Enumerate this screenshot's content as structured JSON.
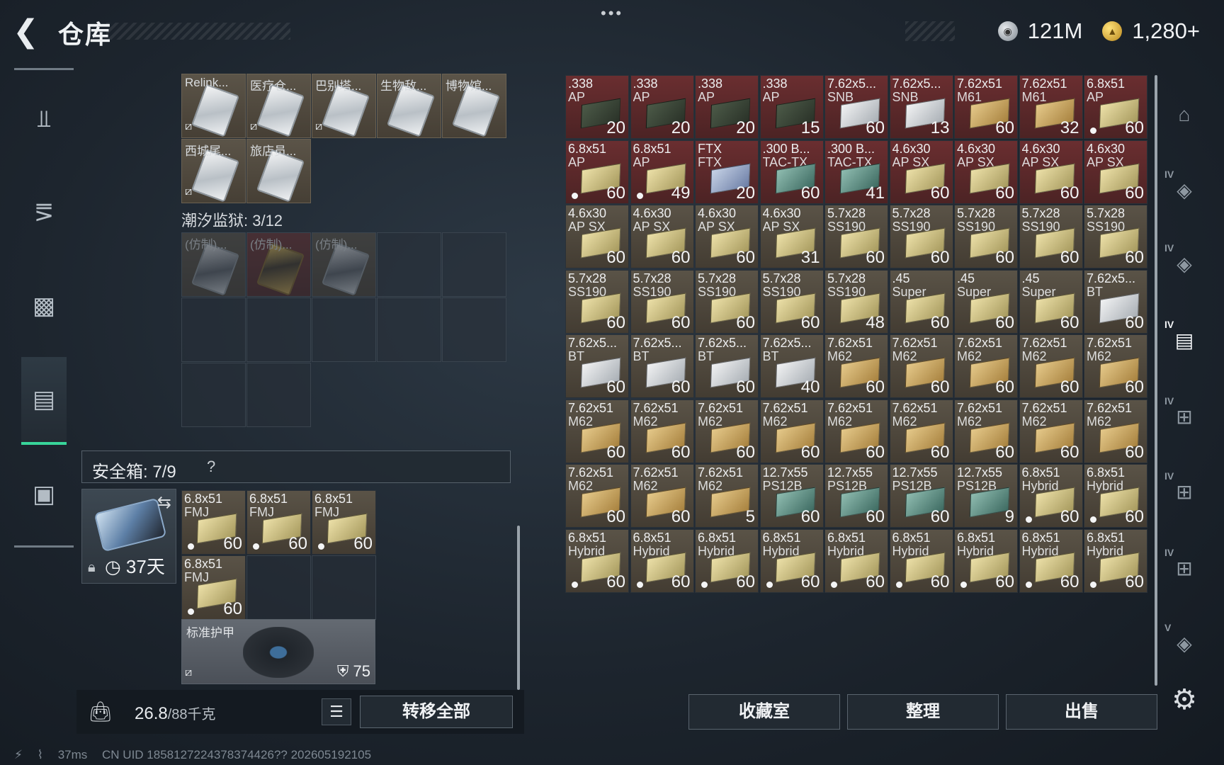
{
  "header": {
    "title": "仓库",
    "more_label": "•••",
    "currency": [
      {
        "icon": "silver-coin-icon",
        "value": "121M"
      },
      {
        "icon": "gold-coin-icon",
        "value": "1,280+"
      }
    ]
  },
  "left_storage": {
    "keycards_row1": [
      {
        "label": "Relink...",
        "nobind": true,
        "style": "silver"
      },
      {
        "label": "医疗仓...",
        "nobind": true,
        "style": "silver"
      },
      {
        "label": "巴别塔...",
        "nobind": true,
        "style": "silver"
      },
      {
        "label": "生物敌...",
        "nobind": false,
        "style": "silver"
      },
      {
        "label": "博物馆...",
        "nobind": false,
        "style": "silver"
      }
    ],
    "keycards_row2": [
      {
        "label": "西城尾...",
        "nobind": true,
        "style": "silver"
      },
      {
        "label": "旅店员...",
        "nobind": false,
        "style": "silver"
      }
    ],
    "prison_title": "潮汐监狱: 3/12",
    "prison_cards": [
      {
        "label": "(仿制)...",
        "style": "dark",
        "red": false
      },
      {
        "label": "(仿制)...",
        "style": "gold",
        "red": true
      },
      {
        "label": "(仿制)...",
        "style": "dark",
        "red": false
      }
    ]
  },
  "safebox": {
    "label": "安全箱:  7/9",
    "help": "?",
    "timer": "37天",
    "items": [
      {
        "name1": "6.8x51",
        "name2": "FMJ",
        "count": "60",
        "dot": true
      },
      {
        "name1": "6.8x51",
        "name2": "FMJ",
        "count": "60",
        "dot": true
      },
      {
        "name1": "6.8x51",
        "name2": "FMJ",
        "count": "60",
        "dot": true
      },
      {
        "name1": "6.8x51",
        "name2": "FMJ",
        "count": "60",
        "dot": true
      }
    ],
    "armor": {
      "label": "标准护甲",
      "value": "75"
    }
  },
  "bottom_left": {
    "weight": "26.8",
    "weight_max": "/88千克",
    "transfer_all": "转移全部"
  },
  "stash": [
    {
      "n1": ".338",
      "n2": "AP",
      "c": "20",
      "bg": "red",
      "box": "green",
      "dot": false
    },
    {
      "n1": ".338",
      "n2": "AP",
      "c": "20",
      "bg": "red",
      "box": "green",
      "dot": false
    },
    {
      "n1": ".338",
      "n2": "AP",
      "c": "20",
      "bg": "red",
      "box": "green",
      "dot": false
    },
    {
      "n1": ".338",
      "n2": "AP",
      "c": "15",
      "bg": "red",
      "box": "green",
      "dot": false
    },
    {
      "n1": "7.62x5...",
      "n2": "SNB",
      "c": "60",
      "bg": "red",
      "box": "white",
      "dot": false
    },
    {
      "n1": "7.62x5...",
      "n2": "SNB",
      "c": "13",
      "bg": "red",
      "box": "white",
      "dot": false
    },
    {
      "n1": "7.62x51",
      "n2": "M61",
      "c": "60",
      "bg": "red",
      "box": "gold",
      "dot": false
    },
    {
      "n1": "7.62x51",
      "n2": "M61",
      "c": "32",
      "bg": "red",
      "box": "gold",
      "dot": false
    },
    {
      "n1": "6.8x51",
      "n2": "AP",
      "c": "60",
      "bg": "red",
      "box": "yellow",
      "dot": true
    },
    {
      "n1": "6.8x51",
      "n2": "AP",
      "c": "60",
      "bg": "red",
      "box": "yellow",
      "dot": true
    },
    {
      "n1": "6.8x51",
      "n2": "AP",
      "c": "49",
      "bg": "red",
      "box": "yellow",
      "dot": true
    },
    {
      "n1": "FTX",
      "n2": "FTX",
      "c": "20",
      "bg": "red",
      "box": "blue",
      "dot": false
    },
    {
      "n1": ".300 B...",
      "n2": "TAC-TX",
      "c": "60",
      "bg": "red",
      "box": "teal",
      "dot": false
    },
    {
      "n1": ".300 B...",
      "n2": "TAC-TX",
      "c": "41",
      "bg": "red",
      "box": "teal",
      "dot": false
    },
    {
      "n1": "4.6x30",
      "n2": "AP SX",
      "c": "60",
      "bg": "red",
      "box": "yellow",
      "dot": false
    },
    {
      "n1": "4.6x30",
      "n2": "AP SX",
      "c": "60",
      "bg": "red",
      "box": "yellow",
      "dot": false
    },
    {
      "n1": "4.6x30",
      "n2": "AP SX",
      "c": "60",
      "bg": "red",
      "box": "yellow",
      "dot": false
    },
    {
      "n1": "4.6x30",
      "n2": "AP SX",
      "c": "60",
      "bg": "red",
      "box": "yellow",
      "dot": false
    },
    {
      "n1": "4.6x30",
      "n2": "AP SX",
      "c": "60",
      "bg": "tan",
      "box": "yellow",
      "dot": false
    },
    {
      "n1": "4.6x30",
      "n2": "AP SX",
      "c": "60",
      "bg": "tan",
      "box": "yellow",
      "dot": false
    },
    {
      "n1": "4.6x30",
      "n2": "AP SX",
      "c": "60",
      "bg": "tan",
      "box": "yellow",
      "dot": false
    },
    {
      "n1": "4.6x30",
      "n2": "AP SX",
      "c": "31",
      "bg": "tan",
      "box": "yellow",
      "dot": false
    },
    {
      "n1": "5.7x28",
      "n2": "SS190",
      "c": "60",
      "bg": "tan",
      "box": "yellow",
      "dot": false
    },
    {
      "n1": "5.7x28",
      "n2": "SS190",
      "c": "60",
      "bg": "tan",
      "box": "yellow",
      "dot": false
    },
    {
      "n1": "5.7x28",
      "n2": "SS190",
      "c": "60",
      "bg": "tan",
      "box": "yellow",
      "dot": false
    },
    {
      "n1": "5.7x28",
      "n2": "SS190",
      "c": "60",
      "bg": "tan",
      "box": "yellow",
      "dot": false
    },
    {
      "n1": "5.7x28",
      "n2": "SS190",
      "c": "60",
      "bg": "tan",
      "box": "yellow",
      "dot": false
    },
    {
      "n1": "5.7x28",
      "n2": "SS190",
      "c": "60",
      "bg": "tan",
      "box": "yellow",
      "dot": false
    },
    {
      "n1": "5.7x28",
      "n2": "SS190",
      "c": "60",
      "bg": "tan",
      "box": "yellow",
      "dot": false
    },
    {
      "n1": "5.7x28",
      "n2": "SS190",
      "c": "60",
      "bg": "tan",
      "box": "yellow",
      "dot": false
    },
    {
      "n1": "5.7x28",
      "n2": "SS190",
      "c": "60",
      "bg": "tan",
      "box": "yellow",
      "dot": false
    },
    {
      "n1": "5.7x28",
      "n2": "SS190",
      "c": "48",
      "bg": "tan",
      "box": "yellow",
      "dot": false
    },
    {
      "n1": ".45",
      "n2": "Super",
      "c": "60",
      "bg": "tan",
      "box": "yellow",
      "dot": false
    },
    {
      "n1": ".45",
      "n2": "Super",
      "c": "60",
      "bg": "tan",
      "box": "yellow",
      "dot": false
    },
    {
      "n1": ".45",
      "n2": "Super",
      "c": "60",
      "bg": "tan",
      "box": "yellow",
      "dot": false
    },
    {
      "n1": "7.62x5...",
      "n2": "BT",
      "c": "60",
      "bg": "tan",
      "box": "white",
      "dot": false
    },
    {
      "n1": "7.62x5...",
      "n2": "BT",
      "c": "60",
      "bg": "tan",
      "box": "white",
      "dot": false
    },
    {
      "n1": "7.62x5...",
      "n2": "BT",
      "c": "60",
      "bg": "tan",
      "box": "white",
      "dot": false
    },
    {
      "n1": "7.62x5...",
      "n2": "BT",
      "c": "60",
      "bg": "tan",
      "box": "white",
      "dot": false
    },
    {
      "n1": "7.62x5...",
      "n2": "BT",
      "c": "40",
      "bg": "tan",
      "box": "white",
      "dot": false
    },
    {
      "n1": "7.62x51",
      "n2": "M62",
      "c": "60",
      "bg": "tan",
      "box": "gold",
      "dot": false
    },
    {
      "n1": "7.62x51",
      "n2": "M62",
      "c": "60",
      "bg": "tan",
      "box": "gold",
      "dot": false
    },
    {
      "n1": "7.62x51",
      "n2": "M62",
      "c": "60",
      "bg": "tan",
      "box": "gold",
      "dot": false
    },
    {
      "n1": "7.62x51",
      "n2": "M62",
      "c": "60",
      "bg": "tan",
      "box": "gold",
      "dot": false
    },
    {
      "n1": "7.62x51",
      "n2": "M62",
      "c": "60",
      "bg": "tan",
      "box": "gold",
      "dot": false
    },
    {
      "n1": "7.62x51",
      "n2": "M62",
      "c": "60",
      "bg": "tan",
      "box": "gold",
      "dot": false
    },
    {
      "n1": "7.62x51",
      "n2": "M62",
      "c": "60",
      "bg": "tan",
      "box": "gold",
      "dot": false
    },
    {
      "n1": "7.62x51",
      "n2": "M62",
      "c": "60",
      "bg": "tan",
      "box": "gold",
      "dot": false
    },
    {
      "n1": "7.62x51",
      "n2": "M62",
      "c": "60",
      "bg": "tan",
      "box": "gold",
      "dot": false
    },
    {
      "n1": "7.62x51",
      "n2": "M62",
      "c": "60",
      "bg": "tan",
      "box": "gold",
      "dot": false
    },
    {
      "n1": "7.62x51",
      "n2": "M62",
      "c": "60",
      "bg": "tan",
      "box": "gold",
      "dot": false
    },
    {
      "n1": "7.62x51",
      "n2": "M62",
      "c": "60",
      "bg": "tan",
      "box": "gold",
      "dot": false
    },
    {
      "n1": "7.62x51",
      "n2": "M62",
      "c": "60",
      "bg": "tan",
      "box": "gold",
      "dot": false
    },
    {
      "n1": "7.62x51",
      "n2": "M62",
      "c": "60",
      "bg": "tan",
      "box": "gold",
      "dot": false
    },
    {
      "n1": "7.62x51",
      "n2": "M62",
      "c": "60",
      "bg": "tan",
      "box": "gold",
      "dot": false
    },
    {
      "n1": "7.62x51",
      "n2": "M62",
      "c": "60",
      "bg": "tan",
      "box": "gold",
      "dot": false
    },
    {
      "n1": "7.62x51",
      "n2": "M62",
      "c": "5",
      "bg": "tan",
      "box": "gold",
      "dot": false
    },
    {
      "n1": "12.7x55",
      "n2": "PS12B",
      "c": "60",
      "bg": "tan",
      "box": "teal",
      "dot": false
    },
    {
      "n1": "12.7x55",
      "n2": "PS12B",
      "c": "60",
      "bg": "tan",
      "box": "teal",
      "dot": false
    },
    {
      "n1": "12.7x55",
      "n2": "PS12B",
      "c": "60",
      "bg": "tan",
      "box": "teal",
      "dot": false
    },
    {
      "n1": "12.7x55",
      "n2": "PS12B",
      "c": "9",
      "bg": "tan",
      "box": "teal",
      "dot": false
    },
    {
      "n1": "6.8x51",
      "n2": "Hybrid",
      "c": "60",
      "bg": "tan",
      "box": "yellow",
      "dot": true
    },
    {
      "n1": "6.8x51",
      "n2": "Hybrid",
      "c": "60",
      "bg": "tan",
      "box": "yellow",
      "dot": true
    },
    {
      "n1": "6.8x51",
      "n2": "Hybrid",
      "c": "60",
      "bg": "tan",
      "box": "yellow",
      "dot": true
    },
    {
      "n1": "6.8x51",
      "n2": "Hybrid",
      "c": "60",
      "bg": "tan",
      "box": "yellow",
      "dot": true
    },
    {
      "n1": "6.8x51",
      "n2": "Hybrid",
      "c": "60",
      "bg": "tan",
      "box": "yellow",
      "dot": true
    },
    {
      "n1": "6.8x51",
      "n2": "Hybrid",
      "c": "60",
      "bg": "tan",
      "box": "yellow",
      "dot": true
    },
    {
      "n1": "6.8x51",
      "n2": "Hybrid",
      "c": "60",
      "bg": "tan",
      "box": "yellow",
      "dot": true
    },
    {
      "n1": "6.8x51",
      "n2": "Hybrid",
      "c": "60",
      "bg": "tan",
      "box": "yellow",
      "dot": true
    },
    {
      "n1": "6.8x51",
      "n2": "Hybrid",
      "c": "60",
      "bg": "tan",
      "box": "yellow",
      "dot": true
    },
    {
      "n1": "6.8x51",
      "n2": "Hybrid",
      "c": "60",
      "bg": "tan",
      "box": "yellow",
      "dot": true
    },
    {
      "n1": "6.8x51",
      "n2": "Hybrid",
      "c": "60",
      "bg": "tan",
      "box": "yellow",
      "dot": true
    }
  ],
  "right_buttons": {
    "collection": "收藏室",
    "sort": "整理",
    "sell": "出售"
  },
  "right_rail": [
    {
      "name": "stash-tab-home",
      "tag": ""
    },
    {
      "name": "stash-tab-iv-1",
      "tag": "IV"
    },
    {
      "name": "stash-tab-iv-2",
      "tag": "IV"
    },
    {
      "name": "stash-tab-iv-3",
      "tag": "IV"
    },
    {
      "name": "stash-tab-iv-add-1",
      "tag": "IV"
    },
    {
      "name": "stash-tab-iv-add-2",
      "tag": "IV"
    },
    {
      "name": "stash-tab-iv-add-3",
      "tag": "IV"
    },
    {
      "name": "stash-tab-v",
      "tag": "V"
    }
  ],
  "status": {
    "ping": "37ms",
    "uid": "CN UID 1858127224378374426?? 202605192105"
  },
  "colors": {
    "accent": "#38d59a",
    "red_cell": "#6a2e30",
    "tan_cell": "#5a5347"
  }
}
